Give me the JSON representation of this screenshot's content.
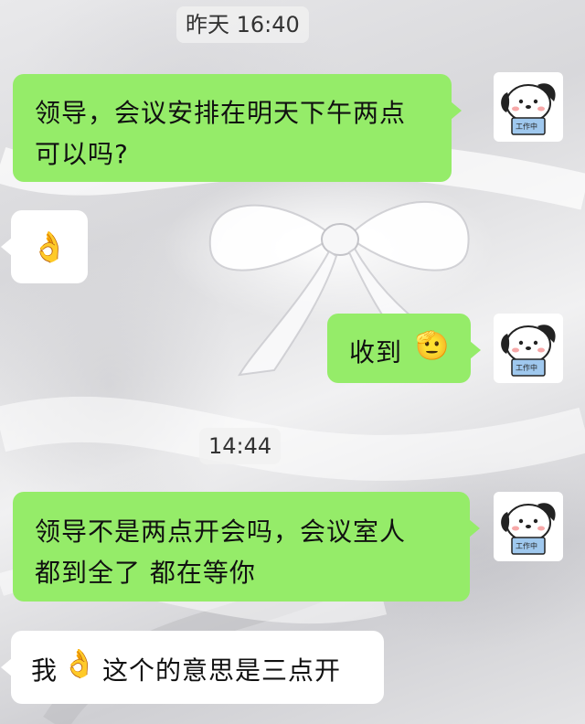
{
  "chat": {
    "timestamps": [
      "昨天 16:40",
      "14:44"
    ],
    "messages": [
      {
        "side": "right",
        "lines": [
          "领导，会议安排在明天下午两点",
          "可以吗?"
        ]
      },
      {
        "side": "left",
        "emoji": "ok-hand-icon"
      },
      {
        "side": "right",
        "text": "收到",
        "emoji": "salute-icon"
      },
      {
        "side": "right",
        "lines": [
          "领导不是两点开会吗，会议室人",
          "都到全了 都在等你"
        ]
      },
      {
        "side": "left",
        "before": "我",
        "emoji": "ok-hand-icon",
        "after": "这个的意思是三点开"
      }
    ],
    "avatar_badge": "工作中"
  },
  "colors": {
    "outgoing_bubble": "#95ec69",
    "incoming_bubble": "#ffffff"
  }
}
